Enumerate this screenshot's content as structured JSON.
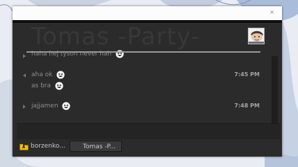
{
  "window": {
    "close_glyph": "×",
    "contact_name": "Tomas -Party-"
  },
  "history": {
    "messages": [
      {
        "arrow": "right",
        "lines": [
          "haha hej tyson never hah"
        ],
        "time": "",
        "emoticon": "laughing-emoticon"
      },
      {
        "arrow": "left",
        "lines": [
          "aha ok",
          "as bra"
        ],
        "time": "7:45 PM",
        "emoticon": "laughing-emoticon"
      },
      {
        "arrow": "right",
        "lines": [
          "jajjamen"
        ],
        "time": "7:48 PM",
        "emoticon": "laughing-emoticon"
      }
    ]
  },
  "tabs": [
    {
      "label": "borzenko...",
      "icon": "folder-icon",
      "active": false
    },
    {
      "label": "Tomas -P...",
      "icon": "",
      "active": true
    }
  ],
  "colors": {
    "window_bg": "#2b2b2b",
    "header_text": "#383838",
    "message_text": "#8e8e8e",
    "time_text": "#a3a3a3"
  }
}
